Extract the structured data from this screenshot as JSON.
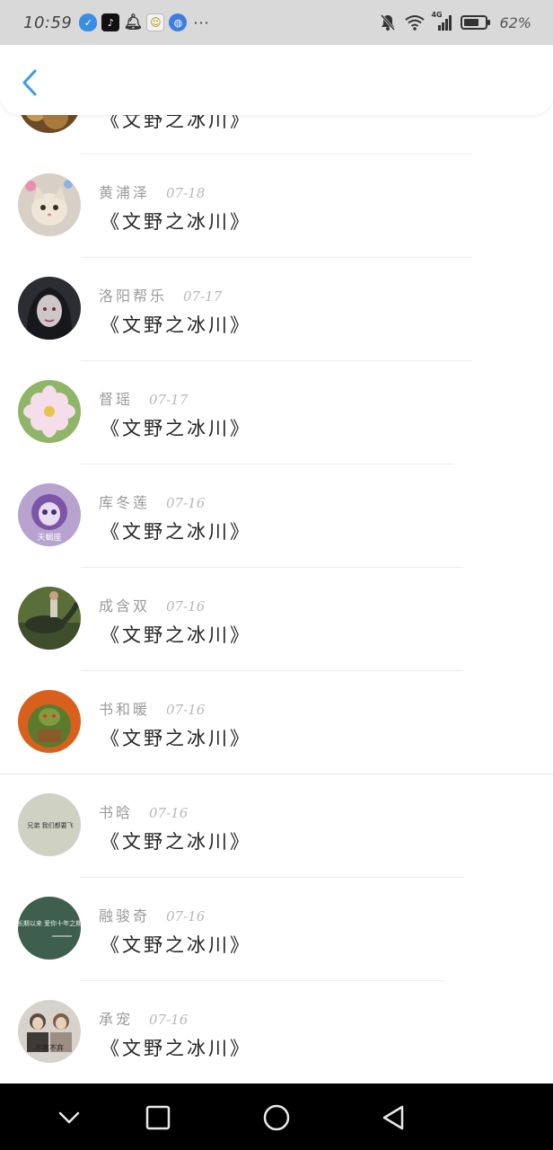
{
  "status_bar": {
    "time": "10:59",
    "notification_icons": [
      "shield-icon",
      "tiktok-icon",
      "bell-icon",
      "face-icon",
      "globe-icon"
    ],
    "more": "···",
    "network": "4G",
    "battery": "62%"
  },
  "header": {
    "back_icon": "chevron-left-icon",
    "accent_color": "#3a9ce8"
  },
  "list": [
    {
      "name": "",
      "date": "",
      "title": "《文野之冰川》",
      "avatar": "food-photo"
    },
    {
      "name": "黄浦泽",
      "date": "07-18",
      "title": "《文野之冰川》",
      "avatar": "kitten"
    },
    {
      "name": "洛阳帮乐",
      "date": "07-17",
      "title": "《文野之冰川》",
      "avatar": "dark-hair-girl"
    },
    {
      "name": "督瑶",
      "date": "07-17",
      "title": "《文野之冰川》",
      "avatar": "pink-flower"
    },
    {
      "name": "库冬莲",
      "date": "07-16",
      "title": "《文野之冰川》",
      "avatar": "purple-cartoon",
      "avatar_text": "天蝎座"
    },
    {
      "name": "成含双",
      "date": "07-16",
      "title": "《文野之冰川》",
      "avatar": "dinosaur-ride"
    },
    {
      "name": "书和暖",
      "date": "07-16",
      "title": "《文野之冰川》",
      "avatar": "orc-warrior"
    },
    {
      "name": "书晗",
      "date": "07-16",
      "title": "《文野之冰川》",
      "avatar": "text-card",
      "avatar_text": "兄弟 我们都要飞"
    },
    {
      "name": "融骏奇",
      "date": "07-16",
      "title": "《文野之冰川》",
      "avatar": "chalkboard",
      "avatar_text": "长期以来 爱你十年之期"
    },
    {
      "name": "承宠",
      "date": "07-16",
      "title": "《文野之冰川》",
      "avatar": "couple-photo",
      "avatar_text": "不离不弃"
    }
  ],
  "nav_bar": {
    "buttons": [
      "chevron-down-icon",
      "square-icon",
      "circle-icon",
      "triangle-back-icon"
    ]
  }
}
